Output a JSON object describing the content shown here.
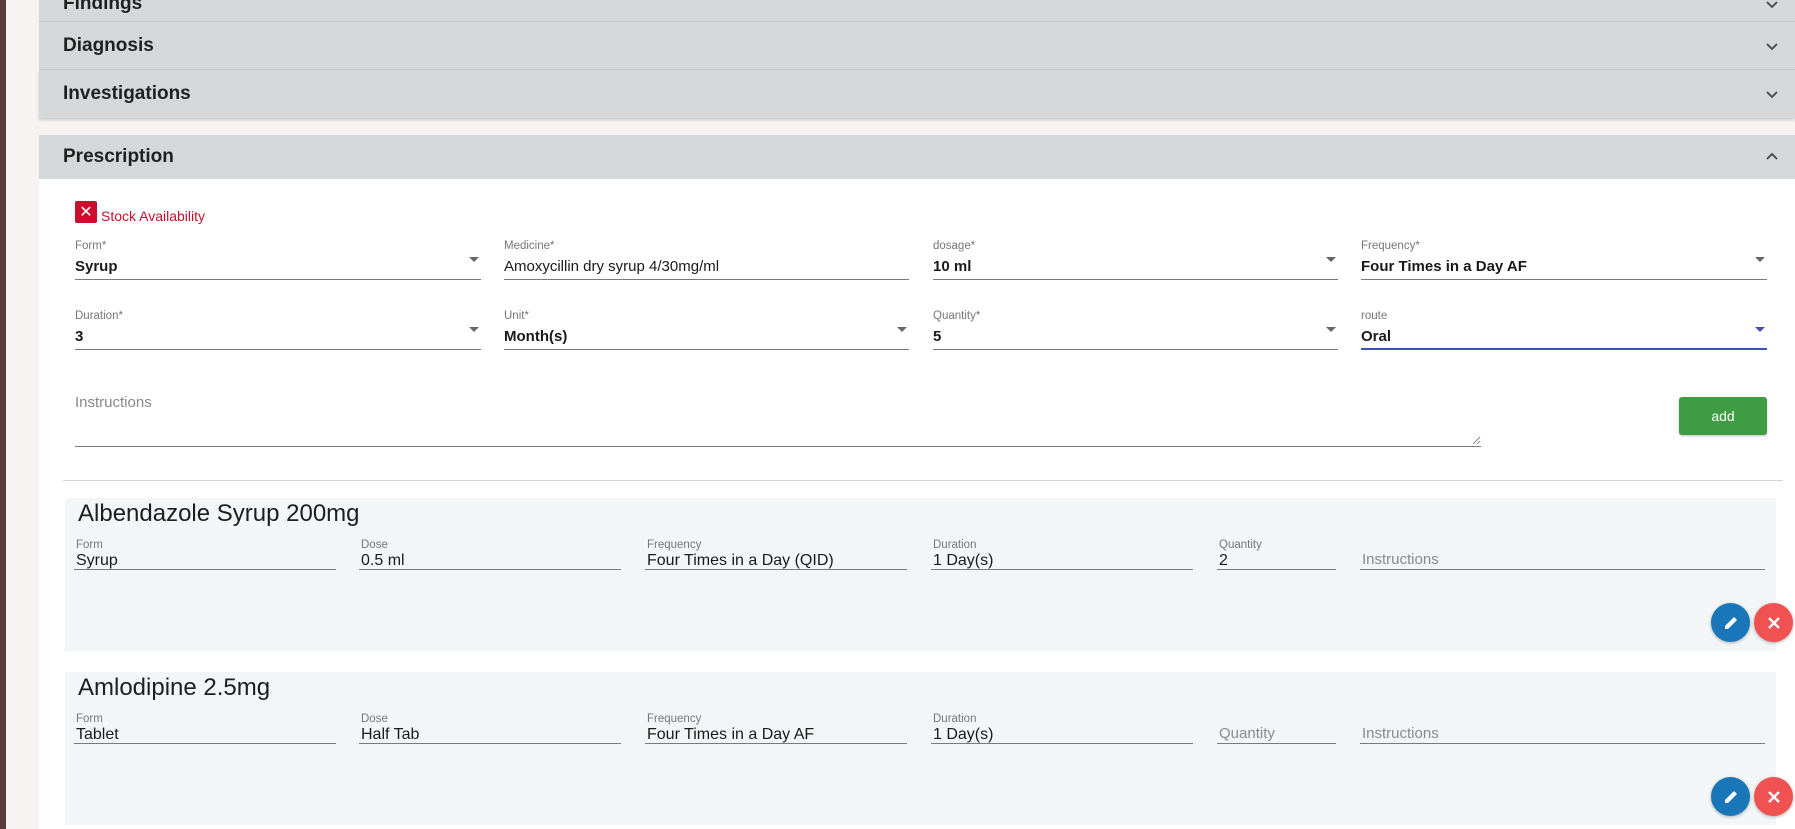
{
  "sections": {
    "findings": "Findings",
    "diagnosis": "Diagnosis",
    "investigations": "Investigations",
    "prescription": "Prescription"
  },
  "stock": {
    "label": "Stock Availability",
    "icon": "close-icon"
  },
  "form": {
    "form": {
      "label": "Form*",
      "value": "Syrup"
    },
    "medicine": {
      "label": "Medicine*",
      "value": "Amoxycillin dry syrup 4/30mg/ml"
    },
    "dosage": {
      "label": "dosage*",
      "value": "10 ml"
    },
    "frequency": {
      "label": "Frequency*",
      "value": "Four Times in a Day AF"
    },
    "duration": {
      "label": "Duration*",
      "value": "3"
    },
    "unit": {
      "label": "Unit*",
      "value": "Month(s)"
    },
    "quantity": {
      "label": "Quantity*",
      "value": "5"
    },
    "route": {
      "label": "route",
      "value": "Oral"
    },
    "instructions_placeholder": "Instructions",
    "add_label": "add"
  },
  "medicines": [
    {
      "name": "Albendazole Syrup 200mg",
      "form_label": "Form",
      "form": "Syrup",
      "dose_label": "Dose",
      "dose": "0.5 ml",
      "frequency_label": "Frequency",
      "frequency": "Four Times in a Day (QID)",
      "duration_label": "Duration",
      "duration": "1 Day(s)",
      "quantity_label": "Quantity",
      "quantity": "2",
      "instructions_placeholder": "Instructions"
    },
    {
      "name": "Amlodipine 2.5mg",
      "form_label": "Form",
      "form": "Tablet",
      "dose_label": "Dose",
      "dose": "Half Tab",
      "frequency_label": "Frequency",
      "frequency": "Four Times in a Day AF",
      "duration_label": "Duration",
      "duration": "1 Day(s)",
      "quantity_placeholder": "Quantity",
      "instructions_placeholder": "Instructions"
    }
  ],
  "colors": {
    "header_bg": "#d5d8db",
    "add_button": "#3e9d42",
    "edit_button": "#1976b8",
    "delete_button": "#f05252",
    "stock_red": "#c8102e",
    "active_underline": "#3f51b5"
  }
}
